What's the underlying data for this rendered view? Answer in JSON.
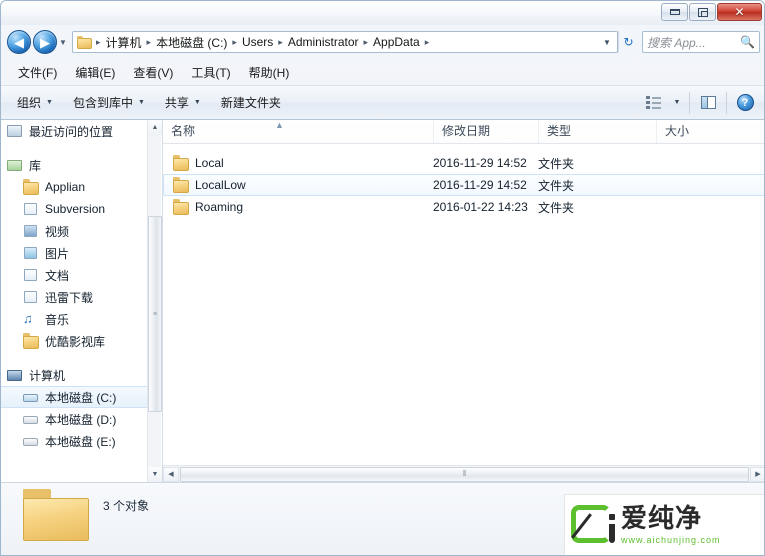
{
  "window": {
    "controls": {
      "minimize_label": "最小化",
      "restore_label": "向下还原",
      "close_label": "✕"
    }
  },
  "address": {
    "back_label": "◀",
    "forward_label": "▶",
    "history_caret": "▼",
    "folder_icon": "folder-icon",
    "breadcrumbs": [
      {
        "label": "计算机"
      },
      {
        "label": "本地磁盘 (C:)"
      },
      {
        "label": "Users"
      },
      {
        "label": "Administrator"
      },
      {
        "label": "AppData"
      }
    ],
    "separator": "▸",
    "dropdown_caret": "▼",
    "refresh_label": "↻"
  },
  "search": {
    "placeholder": "搜索 App...",
    "icon": "search-icon"
  },
  "menubar": {
    "items": [
      {
        "label": "文件(F)"
      },
      {
        "label": "编辑(E)"
      },
      {
        "label": "查看(V)"
      },
      {
        "label": "工具(T)"
      },
      {
        "label": "帮助(H)"
      }
    ]
  },
  "toolbar": {
    "organize_label": "组织",
    "include_library_label": "包含到库中",
    "share_label": "共享",
    "new_folder_label": "新建文件夹",
    "caret": "▼",
    "views_caret": "▼",
    "help_label": "?"
  },
  "sidebar": {
    "items": [
      {
        "label": "最近访问的位置",
        "icon": "recent-places-icon",
        "level": "root",
        "selected": false
      },
      {
        "label": "库",
        "icon": "library-icon",
        "level": "root",
        "selected": false
      },
      {
        "label": "Applian",
        "icon": "folder-icon",
        "level": "child",
        "selected": false
      },
      {
        "label": "Subversion",
        "icon": "document-icon",
        "level": "child",
        "selected": false
      },
      {
        "label": "视频",
        "icon": "video-icon",
        "level": "child",
        "selected": false
      },
      {
        "label": "图片",
        "icon": "picture-icon",
        "level": "child",
        "selected": false
      },
      {
        "label": "文档",
        "icon": "document-icon",
        "level": "child",
        "selected": false
      },
      {
        "label": "迅雷下载",
        "icon": "download-icon",
        "level": "child",
        "selected": false
      },
      {
        "label": "音乐",
        "icon": "music-icon",
        "level": "child",
        "selected": false
      },
      {
        "label": "优酷影视库",
        "icon": "folder-icon",
        "level": "child",
        "selected": false
      },
      {
        "label": "计算机",
        "icon": "computer-icon",
        "level": "root",
        "selected": false
      },
      {
        "label": "本地磁盘 (C:)",
        "icon": "system-drive-icon",
        "level": "child",
        "selected": true
      },
      {
        "label": "本地磁盘 (D:)",
        "icon": "drive-icon",
        "level": "child",
        "selected": false
      },
      {
        "label": "本地磁盘 (E:)",
        "icon": "drive-icon",
        "level": "child",
        "selected": false
      }
    ],
    "scroll_up": "▲",
    "scroll_down": "▼",
    "thumb_grip": "≡"
  },
  "filelist": {
    "columns": [
      {
        "label": "名称"
      },
      {
        "label": "修改日期"
      },
      {
        "label": "类型"
      },
      {
        "label": "大小"
      }
    ],
    "sort_indicator": "▲",
    "rows": [
      {
        "name": "Local",
        "modified": "2016-11-29 14:52",
        "type": "文件夹",
        "size": "",
        "hover": false
      },
      {
        "name": "LocalLow",
        "modified": "2016-11-29 14:52",
        "type": "文件夹",
        "size": "",
        "hover": true
      },
      {
        "name": "Roaming",
        "modified": "2016-01-22 14:23",
        "type": "文件夹",
        "size": "",
        "hover": false
      }
    ],
    "hscroll_left": "◀",
    "hscroll_right": "▶",
    "hscroll_grip": "⦀"
  },
  "status": {
    "item_count_label": "3 个对象",
    "folder_icon": "folder-icon"
  },
  "watermark": {
    "title": "爱纯净",
    "url": "www.aichunjing.com",
    "accent_color": "#5bbf2e"
  }
}
